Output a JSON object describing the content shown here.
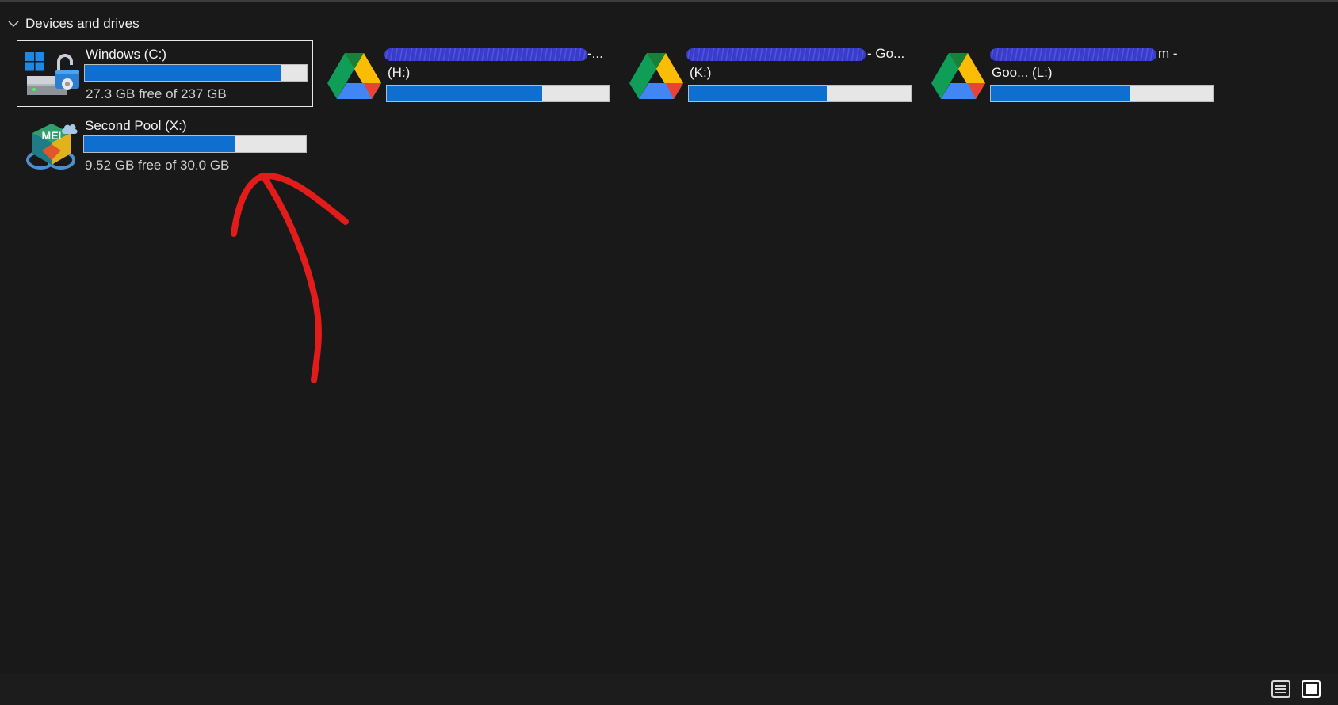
{
  "group": {
    "title": "Devices and drives"
  },
  "drives": [
    {
      "name": "Windows (C:)",
      "free_text": "27.3 GB free of 237 GB",
      "used_fraction": 0.885,
      "icon": "windows-drive-unlocked-icon"
    },
    {
      "name_visible_tail": "-...",
      "letter_line": "(H:)",
      "used_fraction": 0.7,
      "icon": "google-drive-icon"
    },
    {
      "name_visible_tail": "- Go...",
      "letter_line": "(K:)",
      "used_fraction": 0.62,
      "icon": "google-drive-icon"
    },
    {
      "name_visible_tail": "m -",
      "letter_line": "Goo... (L:)",
      "used_fraction": 0.63,
      "icon": "google-drive-icon"
    },
    {
      "name": "Second Pool (X:)",
      "free_text": "9.52 GB free of 30.0 GB",
      "used_fraction": 0.683,
      "icon": "mei-storage-pool-icon",
      "icon_text": "MEI"
    }
  ],
  "annotation": {
    "type": "red-arrow",
    "color": "#e21b1b"
  },
  "status_bar": {
    "details_view": "details-view-icon",
    "tiles_view": "tiles-view-icon"
  },
  "colors": {
    "background": "#191919",
    "bar_fill": "#0f6fd0",
    "bar_track": "#e6e6e6",
    "redaction": "#3b3fd6"
  }
}
